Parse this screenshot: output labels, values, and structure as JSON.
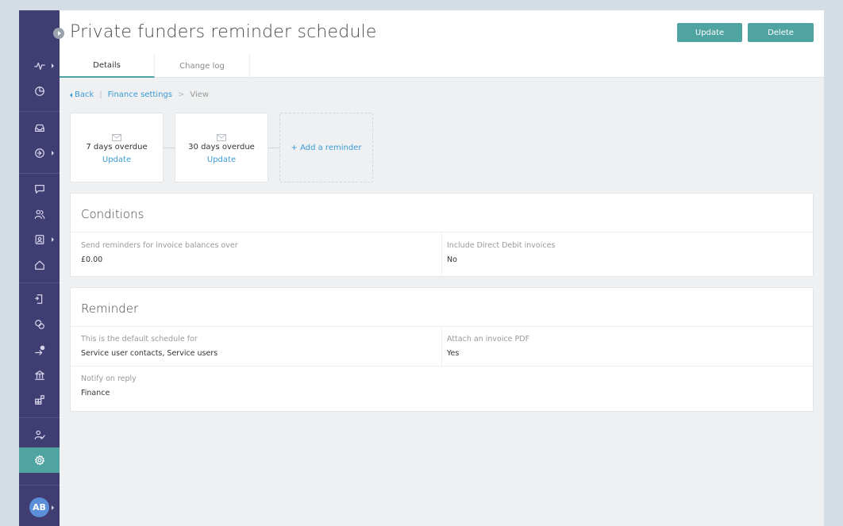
{
  "header": {
    "title": "Private funders reminder schedule",
    "update_label": "Update",
    "delete_label": "Delete"
  },
  "tabs": [
    {
      "label": "Details",
      "active": true
    },
    {
      "label": "Change log",
      "active": false
    }
  ],
  "breadcrumb": {
    "back": "Back",
    "divider": "|",
    "parent": "Finance settings",
    "arrow": ">",
    "current": "View"
  },
  "reminders": [
    {
      "label": "7 days overdue",
      "action": "Update",
      "icon": "envelope-icon"
    },
    {
      "label": "30 days overdue",
      "action": "Update",
      "icon": "envelope-icon"
    }
  ],
  "add_reminder_label": "+ Add a reminder",
  "conditions": {
    "title": "Conditions",
    "fields": [
      {
        "label": "Send reminders for invoice balances over",
        "value": "£0.00"
      },
      {
        "label": "Include Direct Debit invoices",
        "value": "No"
      }
    ]
  },
  "reminder_panel": {
    "title": "Reminder",
    "fields": [
      {
        "label": "This is the default schedule for",
        "value": "Service user contacts, Service users"
      },
      {
        "label": "Attach an invoice PDF",
        "value": "Yes"
      },
      {
        "label": "Notify on reply",
        "value": "Finance"
      }
    ]
  },
  "sidebar": {
    "icons": [
      "activity-icon",
      "clock-icon",
      "inbox-icon",
      "arrow-circle-icon",
      "chat-icon",
      "people-icon",
      "contact-card-icon",
      "home-icon",
      "document-export-icon",
      "coins-icon",
      "send-alert-icon",
      "bank-icon",
      "apps-icon",
      "user-check-icon",
      "settings-icon"
    ],
    "active": "settings-icon"
  },
  "user": {
    "initials": "AB"
  },
  "colors": {
    "sidebar": "#3f3d72",
    "accent": "#4fa3a1",
    "link": "#3c9ad3",
    "avatar": "#5b8fd9"
  }
}
